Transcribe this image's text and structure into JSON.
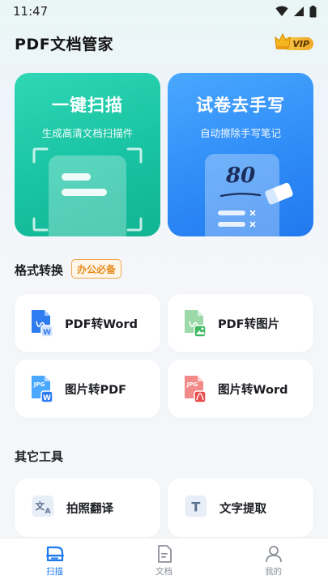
{
  "status_bar": {
    "time": "11:47"
  },
  "header": {
    "title": "PDF文档管家",
    "vip_label": "VIP"
  },
  "hero": {
    "scan": {
      "title": "一键扫描",
      "subtitle": "生成高清文档扫描件"
    },
    "exam": {
      "title": "试卷去手写",
      "subtitle": "自动擦除手写笔记",
      "score_text": "80"
    }
  },
  "format_section": {
    "title": "格式转换",
    "badge": "办公必备",
    "tools": [
      {
        "label": "PDF转Word",
        "icon": "pdf-to-word-icon"
      },
      {
        "label": "PDF转图片",
        "icon": "pdf-to-image-icon"
      },
      {
        "label": "图片转PDF",
        "icon": "image-to-pdf-icon"
      },
      {
        "label": "图片转Word",
        "icon": "image-to-word-icon"
      }
    ]
  },
  "other_section": {
    "title": "其它工具",
    "tools": [
      {
        "label": "拍照翻译",
        "icon": "translate-icon"
      },
      {
        "label": "文字提取",
        "icon": "text-extract-icon"
      }
    ]
  },
  "icon_badges": {
    "word": "W",
    "jpg": "JPG",
    "text_extract": "T"
  },
  "bottom_nav": [
    {
      "label": "扫描",
      "active": true
    },
    {
      "label": "文档",
      "active": false
    },
    {
      "label": "我的",
      "active": false
    }
  ],
  "colors": {
    "scan_green": "#18c3a3",
    "exam_blue": "#2f8cf7",
    "badge_orange": "#e58a1c",
    "nav_active": "#1f7af0"
  }
}
